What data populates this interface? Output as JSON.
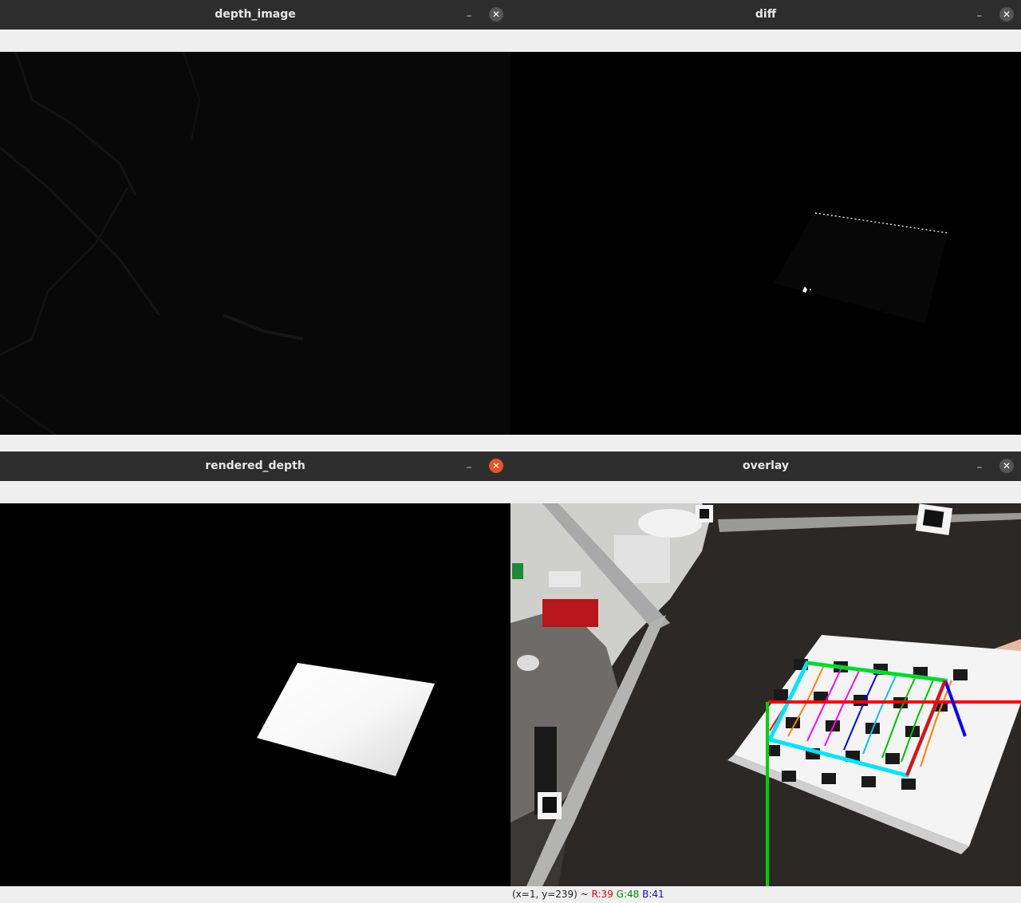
{
  "windows": {
    "depth_image": {
      "title": "depth_image",
      "min_glyph": "–",
      "close_glyph": "✕"
    },
    "diff": {
      "title": "diff",
      "min_glyph": "–",
      "close_glyph": "✕"
    },
    "rendered_depth": {
      "title": "rendered_depth",
      "min_glyph": "–",
      "close_glyph": "✕"
    },
    "overlay": {
      "title": "overlay",
      "min_glyph": "–",
      "close_glyph": "✕",
      "status": {
        "coords": "(x=1, y=239) ~",
        "r": "R:39",
        "g": "G:48",
        "b": "B:41"
      }
    }
  },
  "colors": {
    "active_close": "#e95420",
    "titlebar": "#2d2d2d",
    "axis_x": "#ff0000",
    "axis_y": "#00d000",
    "axis_z": "#0000ff"
  }
}
